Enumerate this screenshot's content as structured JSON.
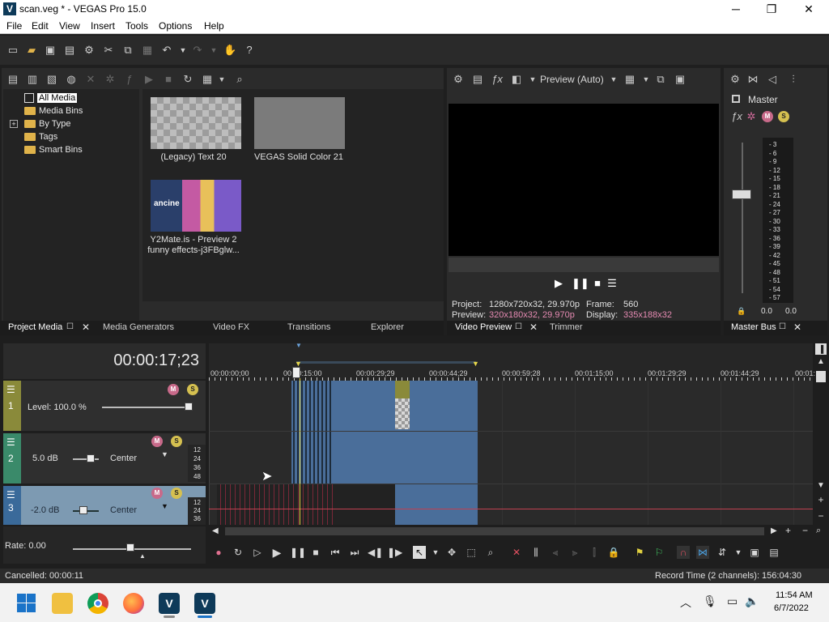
{
  "window": {
    "app_icon": "V",
    "title": "scan.veg * - VEGAS Pro 15.0",
    "minimize": "─",
    "maximize": "❐",
    "close": "✕"
  },
  "menu": [
    "File",
    "Edit",
    "View",
    "Insert",
    "Tools",
    "Options",
    "Help"
  ],
  "project_media": {
    "tree": [
      {
        "label": "All Media",
        "icon": "all-media-icon"
      },
      {
        "label": "Media Bins",
        "icon": "folder-icon"
      },
      {
        "label": "By Type",
        "icon": "folder-icon",
        "expand": "+"
      },
      {
        "label": "Tags",
        "icon": "folder-icon"
      },
      {
        "label": "Smart Bins",
        "icon": "folder-icon"
      }
    ],
    "thumbnails": [
      {
        "caption": "(Legacy) Text 20"
      },
      {
        "caption": "VEGAS Solid Color 21"
      },
      {
        "caption_line1": "Y2Mate.is - Preview 2",
        "caption_line2": "funny effects-j3FBglw..."
      }
    ]
  },
  "preview": {
    "quality": "Preview (Auto)",
    "project_label": "Project:",
    "project_value": "1280x720x32, 29.970p",
    "frame_label": "Frame:",
    "frame_value": "560",
    "preview_label": "Preview:",
    "preview_value": "320x180x32, 29.970p",
    "display_label": "Display:",
    "display_value": "335x188x32"
  },
  "master": {
    "title": "Master",
    "scale": [
      "3",
      "6",
      "9",
      "12",
      "15",
      "18",
      "21",
      "24",
      "27",
      "30",
      "33",
      "36",
      "39",
      "42",
      "45",
      "48",
      "51",
      "54",
      "57"
    ],
    "left_value": "0.0",
    "right_value": "0.0"
  },
  "tabs": {
    "left": [
      "Project Media",
      "Media Generators",
      "Video FX",
      "Transitions",
      "Explorer"
    ],
    "middle": [
      "Video Preview",
      "Trimmer"
    ],
    "right": [
      "Master Bus"
    ],
    "undock": "☐",
    "close": "✕"
  },
  "timeline": {
    "timecode": "00:00:17;23",
    "ruler": [
      "00:00:00;00",
      "00:00:15:00",
      "00:00:29;29",
      "00:00:44;29",
      "00:00:59;28",
      "00:01:15;00",
      "00:01:29;29",
      "00:01:44;29",
      "00:01:"
    ],
    "tracks": [
      {
        "num": "1",
        "level": "Level: 100.0 %"
      },
      {
        "num": "2",
        "volume": "5.0 dB",
        "pan": "Center",
        "meter": [
          "12",
          "24",
          "36",
          "48"
        ]
      },
      {
        "num": "3",
        "volume": "-2.0 dB",
        "pan": "Center",
        "meter": [
          "12",
          "24",
          "36"
        ]
      }
    ],
    "rate": "Rate: 0.00"
  },
  "status": {
    "left": "Cancelled: 00:00:11",
    "right": "Record Time (2 channels): 156:04:30"
  },
  "taskbar": {
    "time": "11:54 AM",
    "date": "6/7/2022",
    "vegas_label": "V"
  },
  "colors": {
    "clip_blue": "#4a6e9a",
    "track1": "#8a8a3a",
    "track2": "#3a8a6a",
    "track3": "#3a6a9a",
    "accent_pink": "#d06a9a"
  }
}
